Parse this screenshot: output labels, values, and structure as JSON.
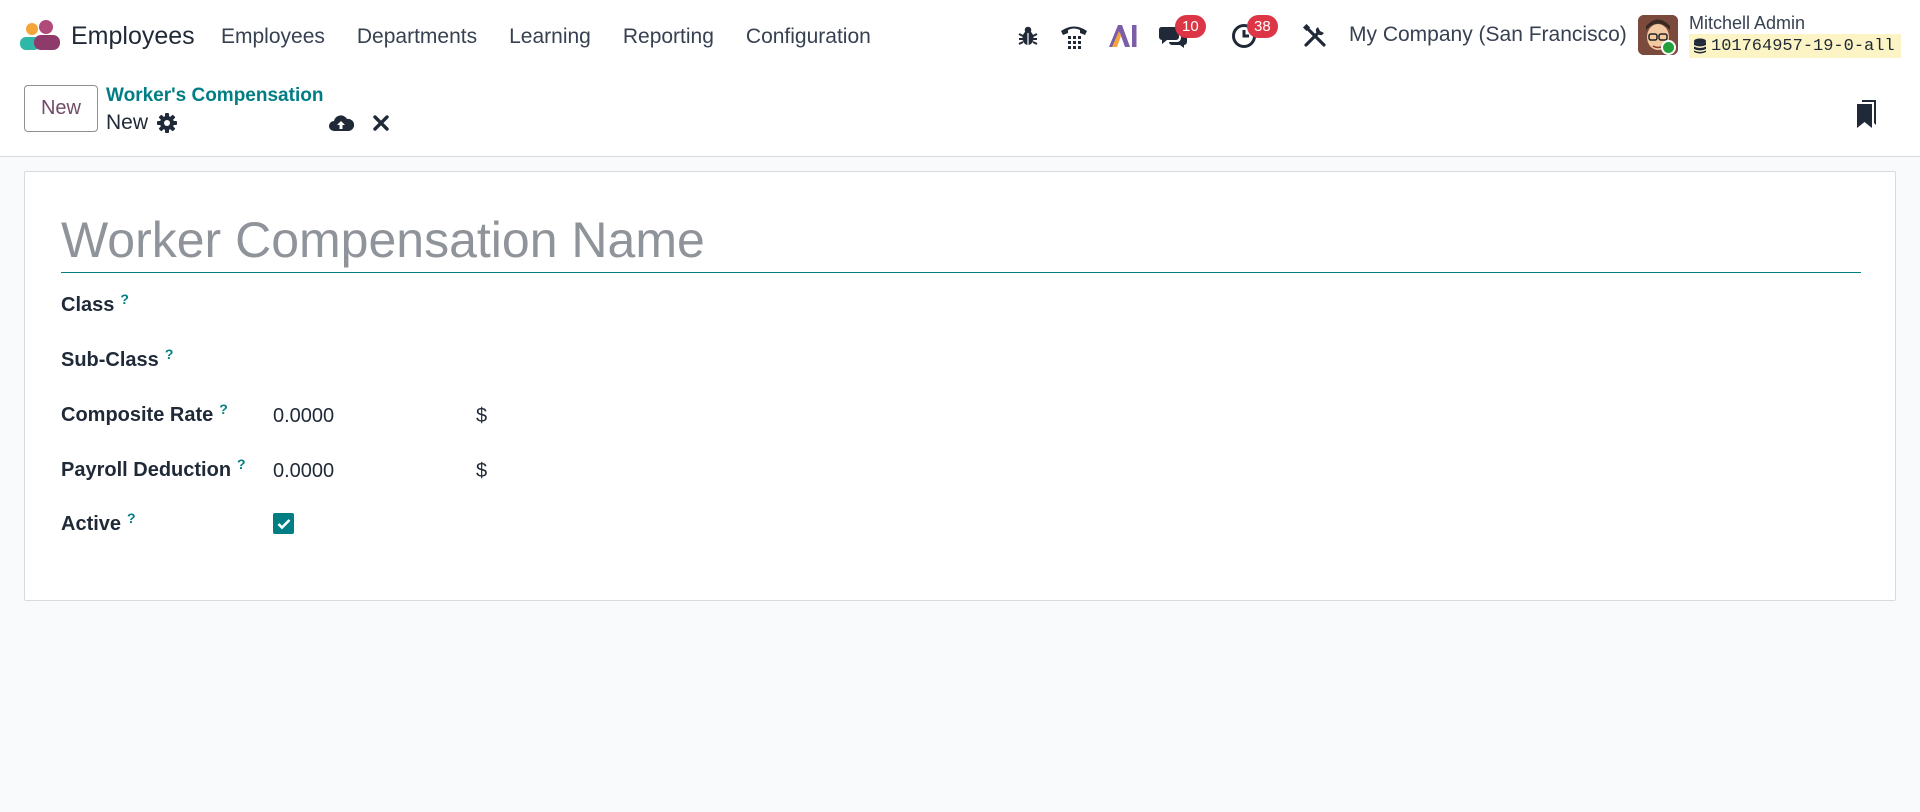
{
  "app": {
    "name": "Employees"
  },
  "menu": [
    {
      "label": "Employees"
    },
    {
      "label": "Departments"
    },
    {
      "label": "Learning"
    },
    {
      "label": "Reporting"
    },
    {
      "label": "Configuration"
    }
  ],
  "systray": {
    "messages_count": "10",
    "activities_count": "38",
    "company": "My Company (San Francisco)",
    "user_name": "Mitchell Admin",
    "database": "101764957-19-0-all"
  },
  "control_panel": {
    "new_button": "New",
    "breadcrumb": "Worker's Compensation",
    "record_name": "New"
  },
  "form": {
    "title_placeholder": "Worker Compensation Name",
    "help_mark": "?",
    "fields": {
      "class": {
        "label": "Class",
        "value": ""
      },
      "sub_class": {
        "label": "Sub-Class",
        "value": ""
      },
      "composite_rate": {
        "label": "Composite Rate",
        "value": "0.0000",
        "currency": "$"
      },
      "payroll_deduction": {
        "label": "Payroll Deduction",
        "value": "0.0000",
        "currency": "$"
      },
      "active": {
        "label": "Active",
        "checked": true
      }
    }
  },
  "colors": {
    "accent": "#017e84",
    "brand": "#714b67",
    "badge": "#dc3545",
    "online": "#22a13a"
  }
}
